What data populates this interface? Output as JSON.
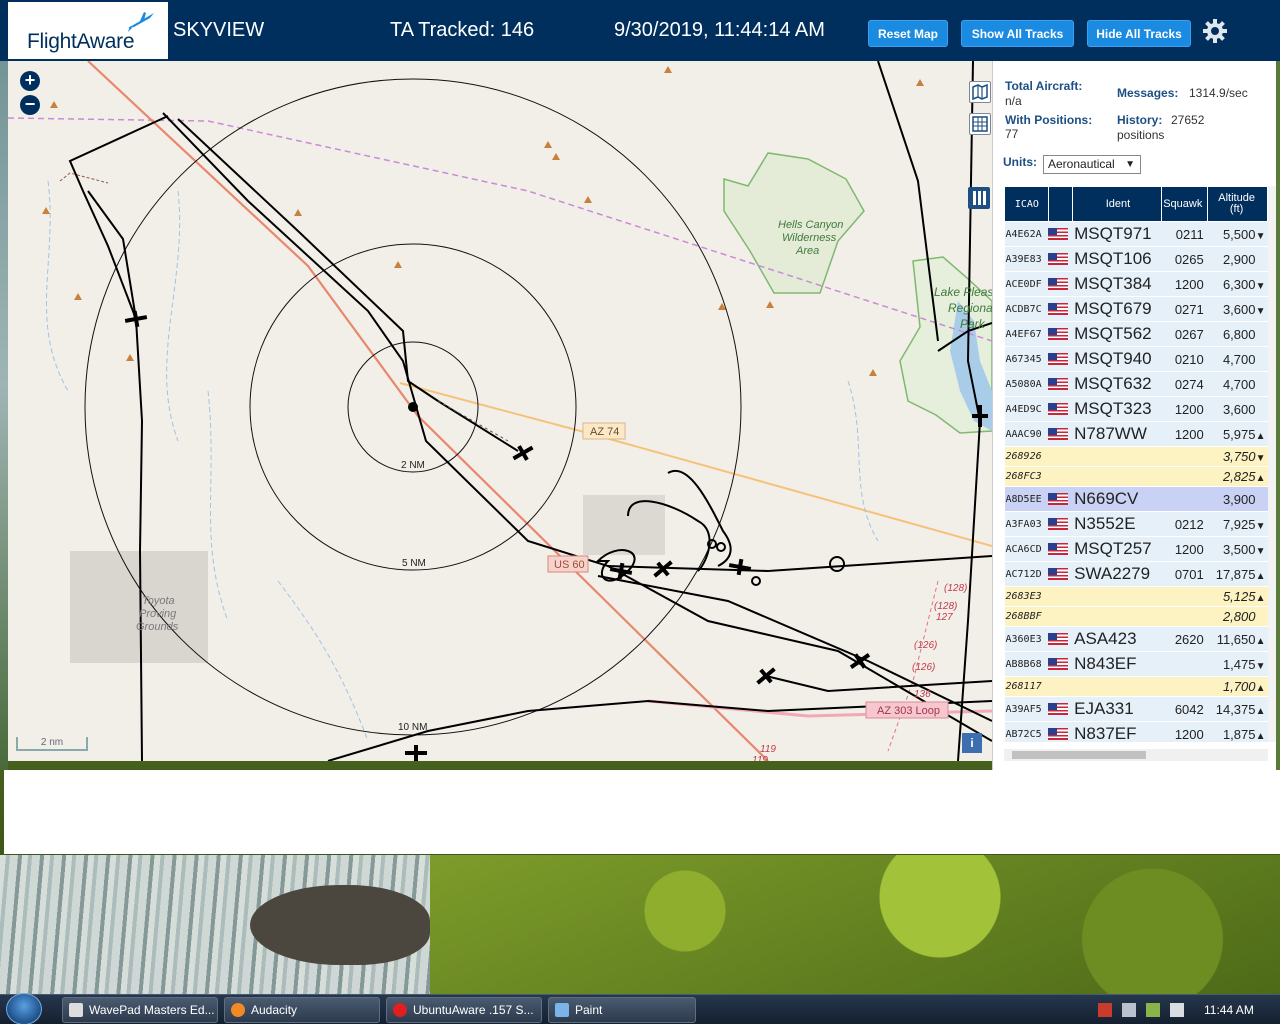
{
  "header": {
    "logo": "FlightAware",
    "app_title": "SKYVIEW",
    "tracked": "TA Tracked: 146",
    "datetime": "9/30/2019, 11:44:14 AM",
    "buttons": {
      "reset": "Reset Map",
      "show_all": "Show All Tracks",
      "hide_all": "Hide All Tracks"
    }
  },
  "map": {
    "ring_labels": [
      "2 NM",
      "5 NM",
      "10 NM"
    ],
    "road_labels": {
      "az74": "AZ 74",
      "us60": "US 60",
      "az303": "AZ 303 Loop"
    },
    "area_labels": {
      "hells_canyon": [
        "Hells Canyon",
        "Wilderness",
        "Area"
      ],
      "lake_pleasant": [
        "Lake Pleas",
        "Regional",
        "Park"
      ],
      "toyota": [
        "Toyota",
        "Proving",
        "Grounds"
      ]
    },
    "route_labels": [
      "(128)",
      "(128)",
      "127",
      "(126)",
      "(126)",
      "136",
      "119",
      "119"
    ],
    "scale": "2 nm",
    "zoom_in": "+",
    "zoom_out": "−",
    "info": "i"
  },
  "panel": {
    "total_aircraft_label": "Total Aircraft:",
    "total_aircraft_value": "n/a",
    "with_positions_label": "With Positions:",
    "with_positions_value": "77",
    "messages_label": "Messages:",
    "messages_value": "1314.9/sec",
    "history_label": "History:",
    "history_value": "27652",
    "history_unit": "positions",
    "units_label": "Units:",
    "units_value": "Aeronautical",
    "columns": {
      "icao": "ICAO",
      "ident": "Ident",
      "squawk": "Squawk",
      "altitude": "Altitude",
      "altitude_unit": "(ft)"
    },
    "rows": [
      {
        "icao": "A4E62A",
        "flag": true,
        "ident": "MSQT971",
        "squawk": "0211",
        "alt": "5,500",
        "trend": "▼",
        "kind": "normal"
      },
      {
        "icao": "A39E83",
        "flag": true,
        "ident": "MSQT106",
        "squawk": "0265",
        "alt": "2,900",
        "trend": "",
        "kind": "normal"
      },
      {
        "icao": "ACE0DF",
        "flag": true,
        "ident": "MSQT384",
        "squawk": "1200",
        "alt": "6,300",
        "trend": "▼",
        "kind": "normal"
      },
      {
        "icao": "ACDB7C",
        "flag": true,
        "ident": "MSQT679",
        "squawk": "0271",
        "alt": "3,600",
        "trend": "▼",
        "kind": "normal"
      },
      {
        "icao": "A4EF67",
        "flag": true,
        "ident": "MSQT562",
        "squawk": "0267",
        "alt": "6,800",
        "trend": "",
        "kind": "normal"
      },
      {
        "icao": "A67345",
        "flag": true,
        "ident": "MSQT940",
        "squawk": "0210",
        "alt": "4,700",
        "trend": "",
        "kind": "normal"
      },
      {
        "icao": "A5080A",
        "flag": true,
        "ident": "MSQT632",
        "squawk": "0274",
        "alt": "4,700",
        "trend": "",
        "kind": "normal"
      },
      {
        "icao": "A4ED9C",
        "flag": true,
        "ident": "MSQT323",
        "squawk": "1200",
        "alt": "3,600",
        "trend": "",
        "kind": "normal"
      },
      {
        "icao": "AAAC90",
        "flag": true,
        "ident": "N787WW",
        "squawk": "1200",
        "alt": "5,975",
        "trend": "▲",
        "kind": "normal"
      },
      {
        "icao": "268926",
        "flag": false,
        "ident": "",
        "squawk": "",
        "alt": "3,750",
        "trend": "▼",
        "kind": "nopos"
      },
      {
        "icao": "268FC3",
        "flag": false,
        "ident": "",
        "squawk": "",
        "alt": "2,825",
        "trend": "▲",
        "kind": "nopos"
      },
      {
        "icao": "A8D5EE",
        "flag": true,
        "ident": "N669CV",
        "squawk": "",
        "alt": "3,900",
        "trend": "",
        "kind": "selected"
      },
      {
        "icao": "A3FA03",
        "flag": true,
        "ident": "N3552E",
        "squawk": "0212",
        "alt": "7,925",
        "trend": "▼",
        "kind": "normal"
      },
      {
        "icao": "ACA6CD",
        "flag": true,
        "ident": "MSQT257",
        "squawk": "1200",
        "alt": "3,500",
        "trend": "▼",
        "kind": "normal"
      },
      {
        "icao": "AC712D",
        "flag": true,
        "ident": "SWA2279",
        "squawk": "0701",
        "alt": "17,875",
        "trend": "▲",
        "kind": "normal"
      },
      {
        "icao": "2683E3",
        "flag": false,
        "ident": "",
        "squawk": "",
        "alt": "5,125",
        "trend": "▲",
        "kind": "nopos"
      },
      {
        "icao": "268BBF",
        "flag": false,
        "ident": "",
        "squawk": "",
        "alt": "2,800",
        "trend": "",
        "kind": "nopos"
      },
      {
        "icao": "A360E3",
        "flag": true,
        "ident": "ASA423",
        "squawk": "2620",
        "alt": "11,650",
        "trend": "▲",
        "kind": "normal"
      },
      {
        "icao": "AB8B68",
        "flag": true,
        "ident": "N843EF",
        "squawk": "",
        "alt": "1,475",
        "trend": "▼",
        "kind": "normal"
      },
      {
        "icao": "268117",
        "flag": false,
        "ident": "",
        "squawk": "",
        "alt": "1,700",
        "trend": "▲",
        "kind": "nopos"
      },
      {
        "icao": "A39AF5",
        "flag": true,
        "ident": "EJA331",
        "squawk": "6042",
        "alt": "14,375",
        "trend": "▲",
        "kind": "normal"
      },
      {
        "icao": "AB72C5",
        "flag": true,
        "ident": "N837EF",
        "squawk": "1200",
        "alt": "1,875",
        "trend": "▲",
        "kind": "normal"
      }
    ]
  },
  "taskbar": {
    "items": [
      "WavePad Masters Ed...",
      "Audacity",
      "UbuntuAware .157 S...",
      "Paint"
    ],
    "clock": "11:44 AM"
  },
  "colors": {
    "header_bg": "#002f5d",
    "button_bg": "#1a8be0",
    "row_bg": "#e6f0f8",
    "row_nopos_bg": "#fdf2c2",
    "row_selected_bg": "#c9d2f4",
    "track": "#000000",
    "road_az74": "#f6c27a",
    "road_us60": "#e9876e",
    "boundary": "#c98ad9",
    "wilderness": "#7fb86f"
  }
}
